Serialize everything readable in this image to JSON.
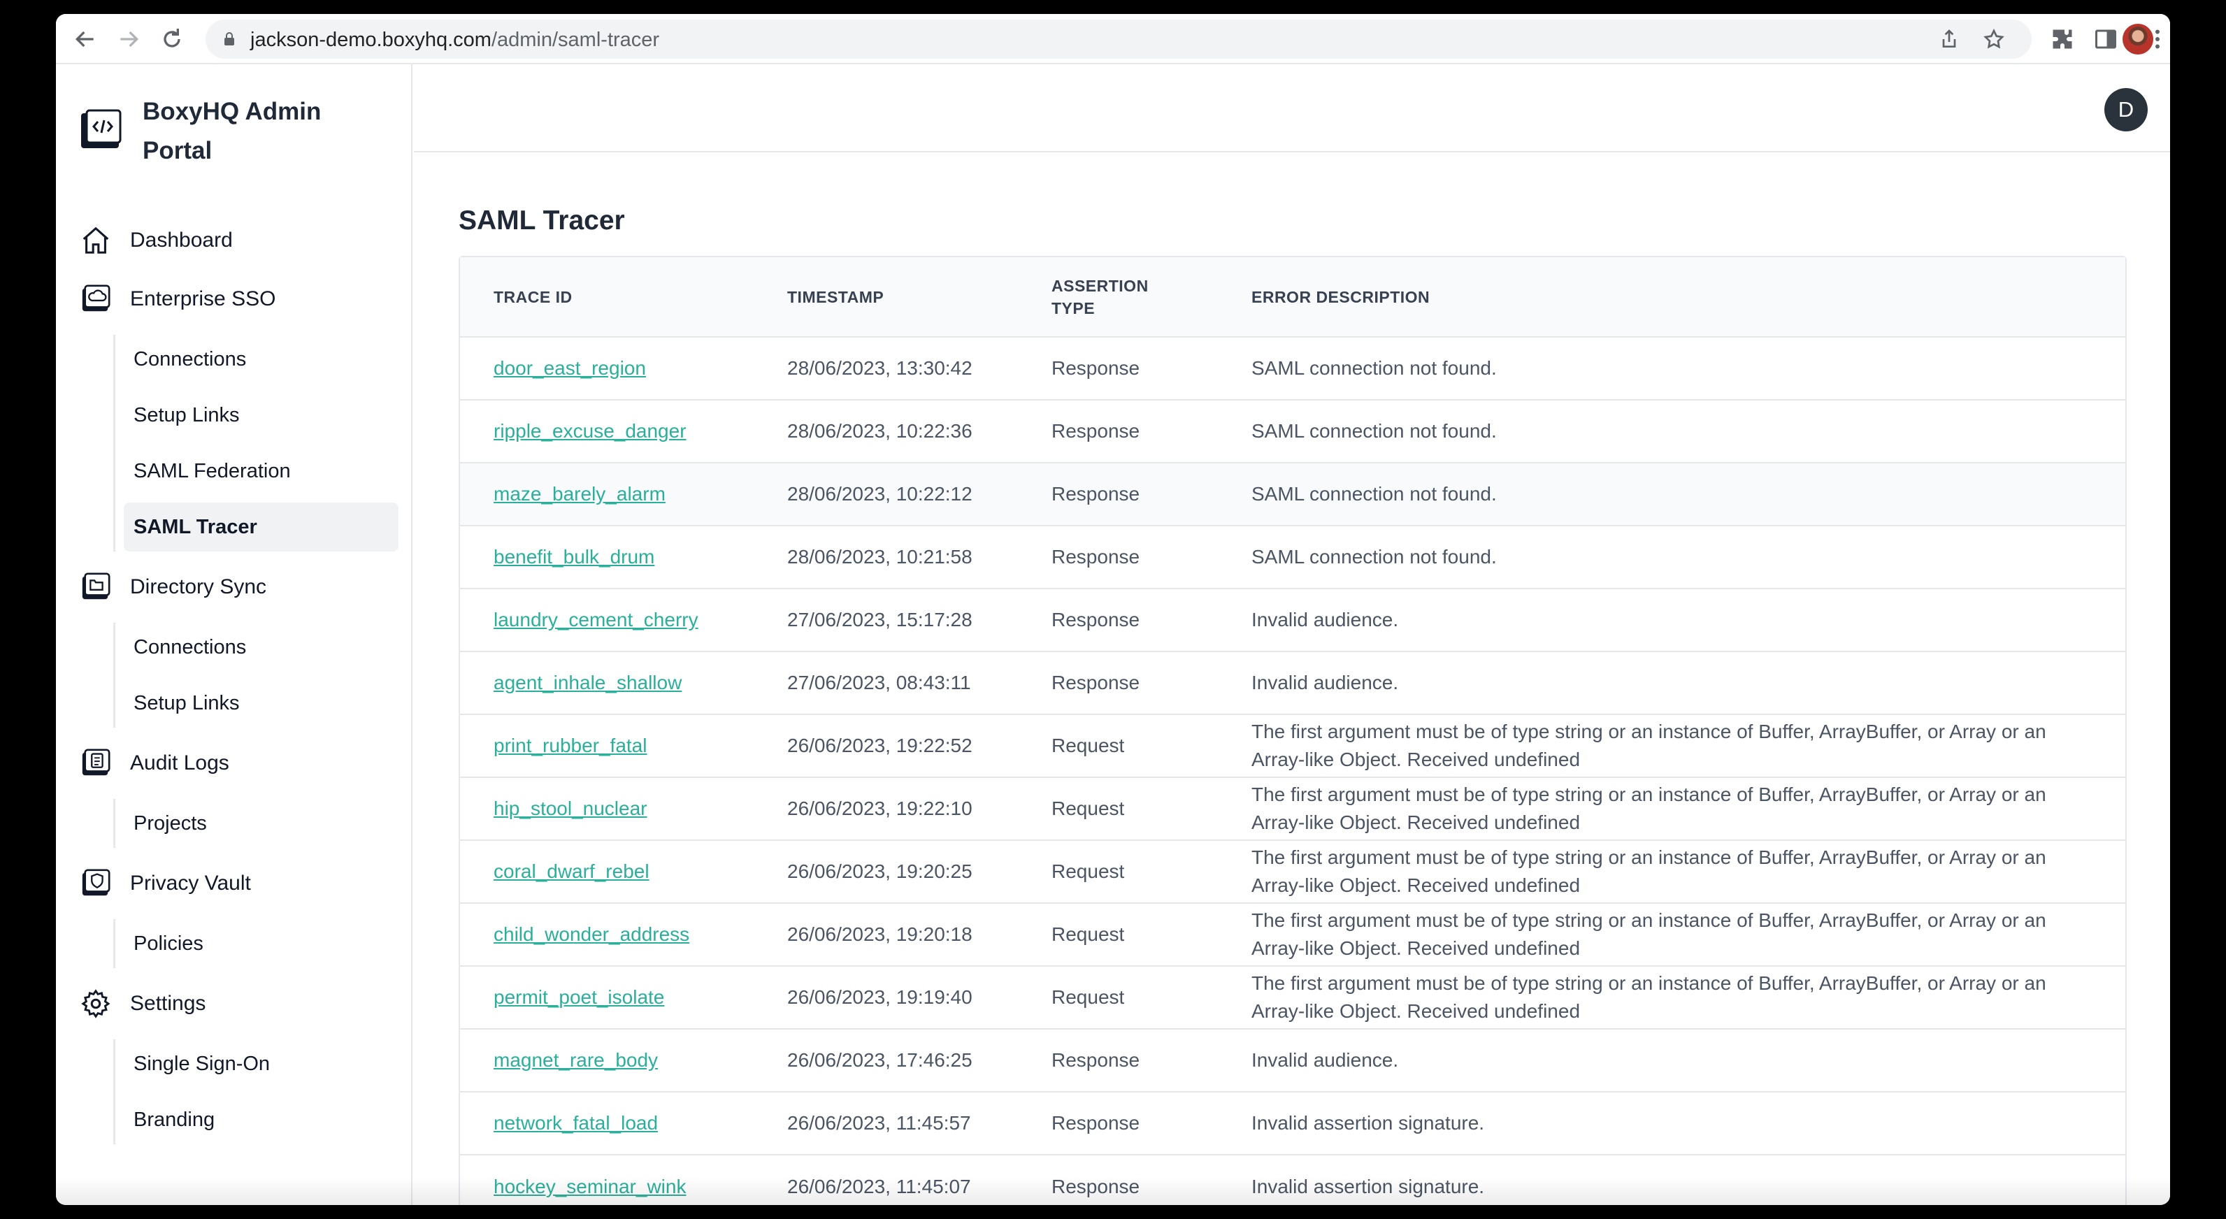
{
  "browser": {
    "url_host": "jackson-demo.boxyhq.com",
    "url_path": "/admin/saml-tracer"
  },
  "brand": {
    "title": "BoxyHQ Admin Portal"
  },
  "nav": {
    "dashboard": "Dashboard",
    "enterprise_sso": "Enterprise SSO",
    "sso_connections": "Connections",
    "sso_setup_links": "Setup Links",
    "saml_federation": "SAML Federation",
    "saml_tracer": "SAML Tracer",
    "directory_sync": "Directory Sync",
    "dsync_connections": "Connections",
    "dsync_setup_links": "Setup Links",
    "audit_logs": "Audit Logs",
    "projects": "Projects",
    "privacy_vault": "Privacy Vault",
    "policies": "Policies",
    "settings": "Settings",
    "single_sign_on": "Single Sign-On",
    "branding": "Branding"
  },
  "user": {
    "avatar_initial": "D"
  },
  "page": {
    "title": "SAML Tracer"
  },
  "table": {
    "headers": [
      "TRACE ID",
      "TIMESTAMP",
      "ASSERTION TYPE",
      "ERROR DESCRIPTION"
    ],
    "rows": [
      {
        "id": "door_east_region",
        "ts": "28/06/2023, 13:30:42",
        "type": "Response",
        "err": "SAML connection not found."
      },
      {
        "id": "ripple_excuse_danger",
        "ts": "28/06/2023, 10:22:36",
        "type": "Response",
        "err": "SAML connection not found."
      },
      {
        "id": "maze_barely_alarm",
        "ts": "28/06/2023, 10:22:12",
        "type": "Response",
        "err": "SAML connection not found."
      },
      {
        "id": "benefit_bulk_drum",
        "ts": "28/06/2023, 10:21:58",
        "type": "Response",
        "err": "SAML connection not found."
      },
      {
        "id": "laundry_cement_cherry",
        "ts": "27/06/2023, 15:17:28",
        "type": "Response",
        "err": "Invalid audience."
      },
      {
        "id": "agent_inhale_shallow",
        "ts": "27/06/2023, 08:43:11",
        "type": "Response",
        "err": "Invalid audience."
      },
      {
        "id": "print_rubber_fatal",
        "ts": "26/06/2023, 19:22:52",
        "type": "Request",
        "err": "The first argument must be of type string or an instance of Buffer, ArrayBuffer, or Array or an Array-like Object. Received undefined"
      },
      {
        "id": "hip_stool_nuclear",
        "ts": "26/06/2023, 19:22:10",
        "type": "Request",
        "err": "The first argument must be of type string or an instance of Buffer, ArrayBuffer, or Array or an Array-like Object. Received undefined"
      },
      {
        "id": "coral_dwarf_rebel",
        "ts": "26/06/2023, 19:20:25",
        "type": "Request",
        "err": "The first argument must be of type string or an instance of Buffer, ArrayBuffer, or Array or an Array-like Object. Received undefined"
      },
      {
        "id": "child_wonder_address",
        "ts": "26/06/2023, 19:20:18",
        "type": "Request",
        "err": "The first argument must be of type string or an instance of Buffer, ArrayBuffer, or Array or an Array-like Object. Received undefined"
      },
      {
        "id": "permit_poet_isolate",
        "ts": "26/06/2023, 19:19:40",
        "type": "Request",
        "err": "The first argument must be of type string or an instance of Buffer, ArrayBuffer, or Array or an Array-like Object. Received undefined"
      },
      {
        "id": "magnet_rare_body",
        "ts": "26/06/2023, 17:46:25",
        "type": "Response",
        "err": "Invalid audience."
      },
      {
        "id": "network_fatal_load",
        "ts": "26/06/2023, 11:45:57",
        "type": "Response",
        "err": "Invalid assertion signature."
      },
      {
        "id": "hockey_seminar_wink",
        "ts": "26/06/2023, 11:45:07",
        "type": "Response",
        "err": "Invalid assertion signature."
      }
    ]
  },
  "colors": {
    "link": "#2ab09a",
    "active_bg": "#f1f2f4",
    "avatar_bg": "#2a323c"
  },
  "icons": [
    "back-arrow-icon",
    "forward-arrow-icon",
    "reload-icon",
    "lock-icon",
    "share-icon",
    "star-icon",
    "extensions-icon",
    "side-panel-icon",
    "menu-dots-icon",
    "home-icon",
    "cloud-icon",
    "folder-icon",
    "clipboard-icon",
    "shield-icon",
    "gear-icon"
  ]
}
